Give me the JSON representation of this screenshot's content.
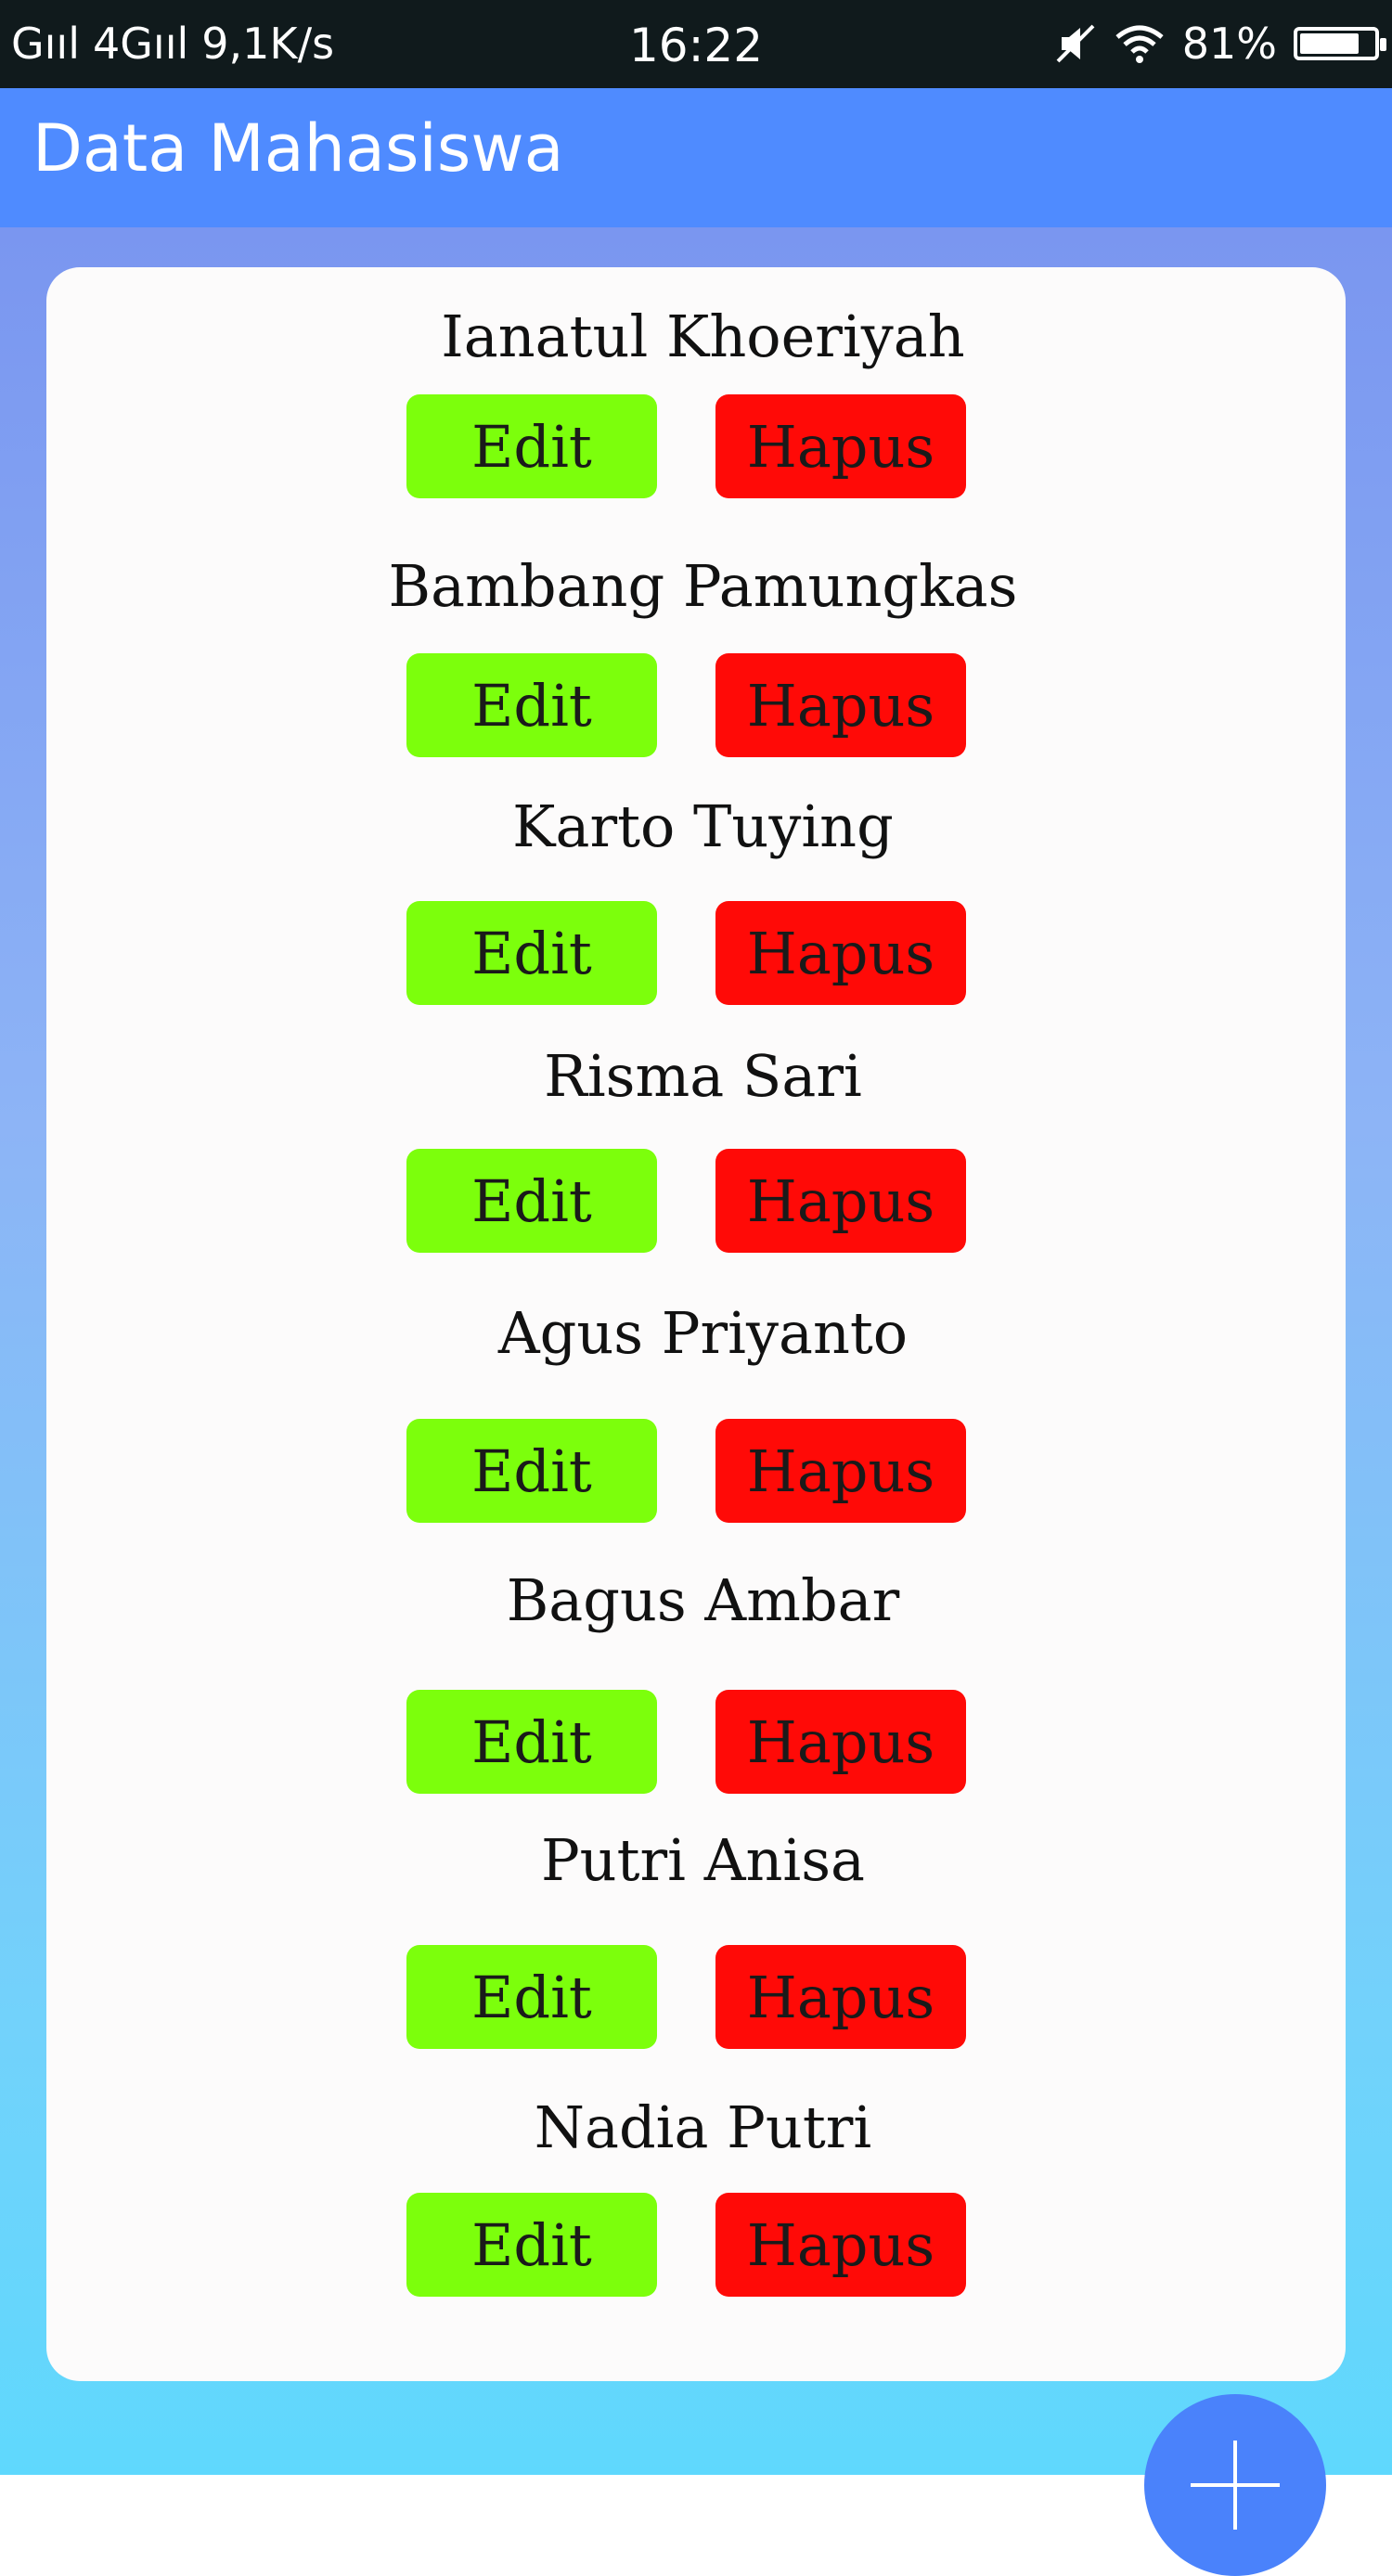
{
  "status_bar": {
    "signal_1": "Gııl",
    "signal_2": "4Gııl",
    "speed": "9,1K/s",
    "time": "16:22",
    "battery_percent": "81%",
    "battery_level": 0.81
  },
  "app_bar": {
    "title": "Data Mahasiswa",
    "color": "#4f8bff"
  },
  "students": [
    {
      "name": "Ianatul Khoeriyah",
      "edit_label": "Edit",
      "delete_label": "Hapus"
    },
    {
      "name": "Bambang Pamungkas",
      "edit_label": "Edit",
      "delete_label": "Hapus"
    },
    {
      "name": "Karto Tuying",
      "edit_label": "Edit",
      "delete_label": "Hapus"
    },
    {
      "name": "Risma Sari",
      "edit_label": "Edit",
      "delete_label": "Hapus"
    },
    {
      "name": "Agus Priyanto",
      "edit_label": "Edit",
      "delete_label": "Hapus"
    },
    {
      "name": "Bagus Ambar",
      "edit_label": "Edit",
      "delete_label": "Hapus"
    },
    {
      "name": "Putri Anisa",
      "edit_label": "Edit",
      "delete_label": "Hapus"
    },
    {
      "name": "Nadia Putri",
      "edit_label": "Edit",
      "delete_label": "Hapus"
    }
  ],
  "colors": {
    "edit_button": "#7cff0c",
    "delete_button": "#ff0a07",
    "fab": "#4a82fb"
  },
  "fab": {
    "icon": "plus-icon"
  }
}
